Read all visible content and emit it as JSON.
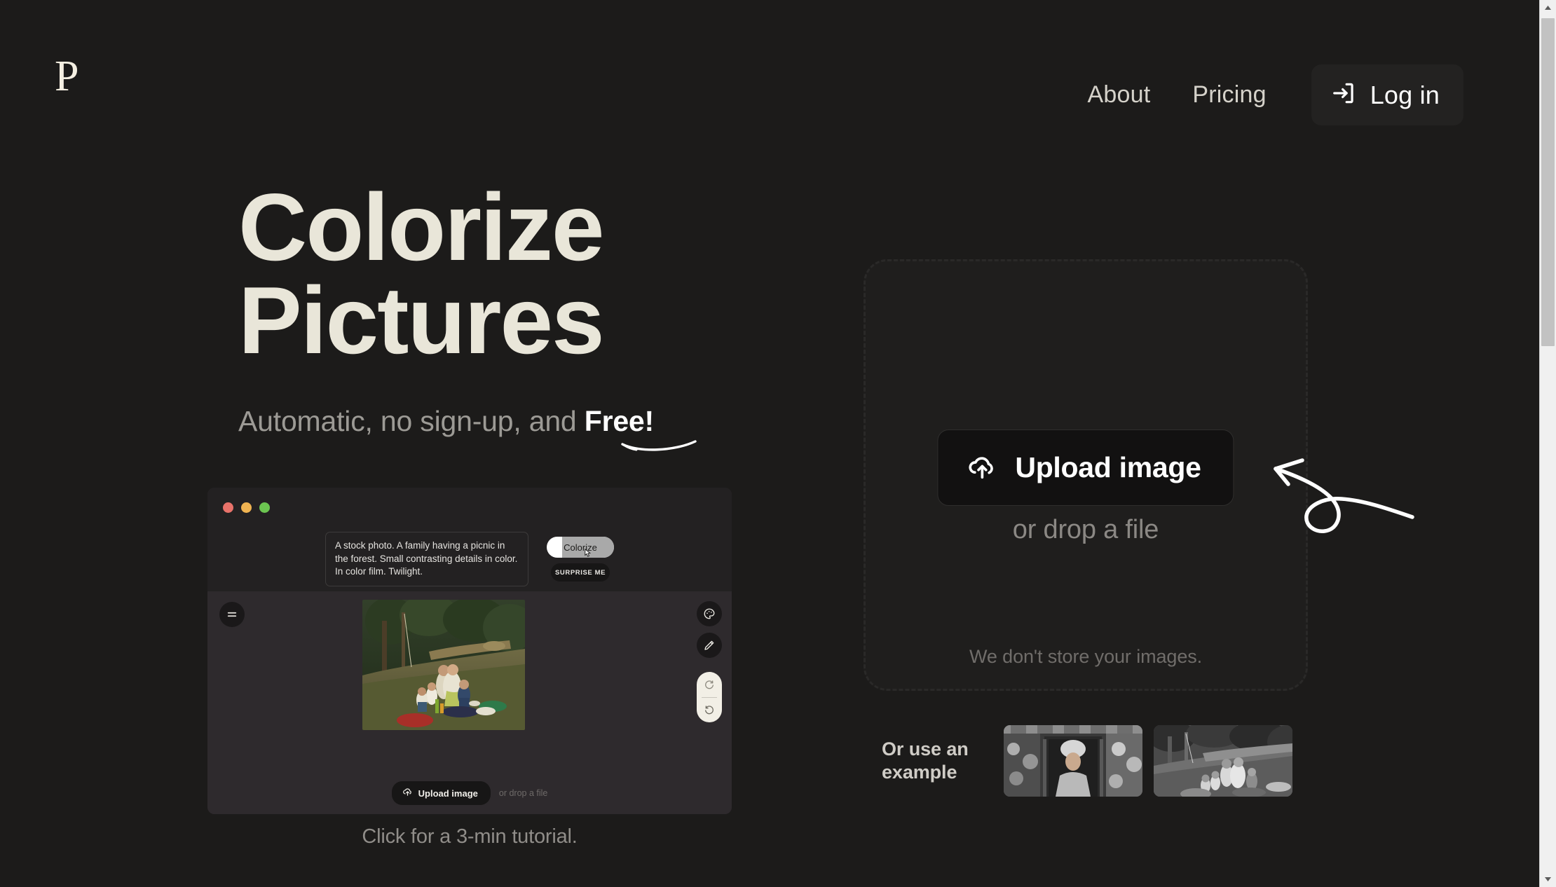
{
  "theme": {
    "background": "#1c1b1a",
    "cream": "#e9e6d9",
    "muted": "#8b8884",
    "white": "#ffffff",
    "panel": "#1f1e1d"
  },
  "header": {
    "logo": "P",
    "nav": [
      {
        "label": "About",
        "name": "nav-link-about"
      },
      {
        "label": "Pricing",
        "name": "nav-link-pricing"
      }
    ],
    "login": {
      "label": "Log in",
      "icon": "login-icon"
    }
  },
  "hero": {
    "title_line1": "Colorize",
    "title_line2": "Pictures",
    "subtitle_prefix": "Automatic, no sign-up, and ",
    "subtitle_highlight": "Free!",
    "tutorial": "Click for a 3-min tutorial."
  },
  "mockup": {
    "window_dots": [
      "red",
      "yellow",
      "green"
    ],
    "prompt": "A stock photo. A family having a picnic in the forest. Small contrasting details in color. In color film. Twilight.",
    "colorize_label": "Colorize",
    "surprise_label": "SURPRISE ME",
    "tools": [
      {
        "name": "compare-icon",
        "label": "compare"
      },
      {
        "name": "palette-icon",
        "label": "palette"
      },
      {
        "name": "pencil-icon",
        "label": "pencil"
      },
      {
        "name": "redo-icon",
        "label": "redo"
      },
      {
        "name": "undo-icon",
        "label": "undo"
      }
    ],
    "upload_label": "Upload image",
    "drop_text": "or drop a file",
    "photo_alt": "colorized family picnic in forest"
  },
  "dropzone": {
    "upload_label": "Upload image",
    "upload_icon": "cloud-upload-icon",
    "drop_text": "or drop a file",
    "store_note": "We don't store your images."
  },
  "examples": {
    "label": "Or use an example",
    "items": [
      {
        "name": "example-thumbnail-portrait",
        "alt": "black and white portrait of a woman with floral screens"
      },
      {
        "name": "example-thumbnail-picnic",
        "alt": "black and white family picnic in forest"
      }
    ]
  },
  "scrollbar": {
    "position": "top",
    "thumb_fraction": "0.37"
  }
}
